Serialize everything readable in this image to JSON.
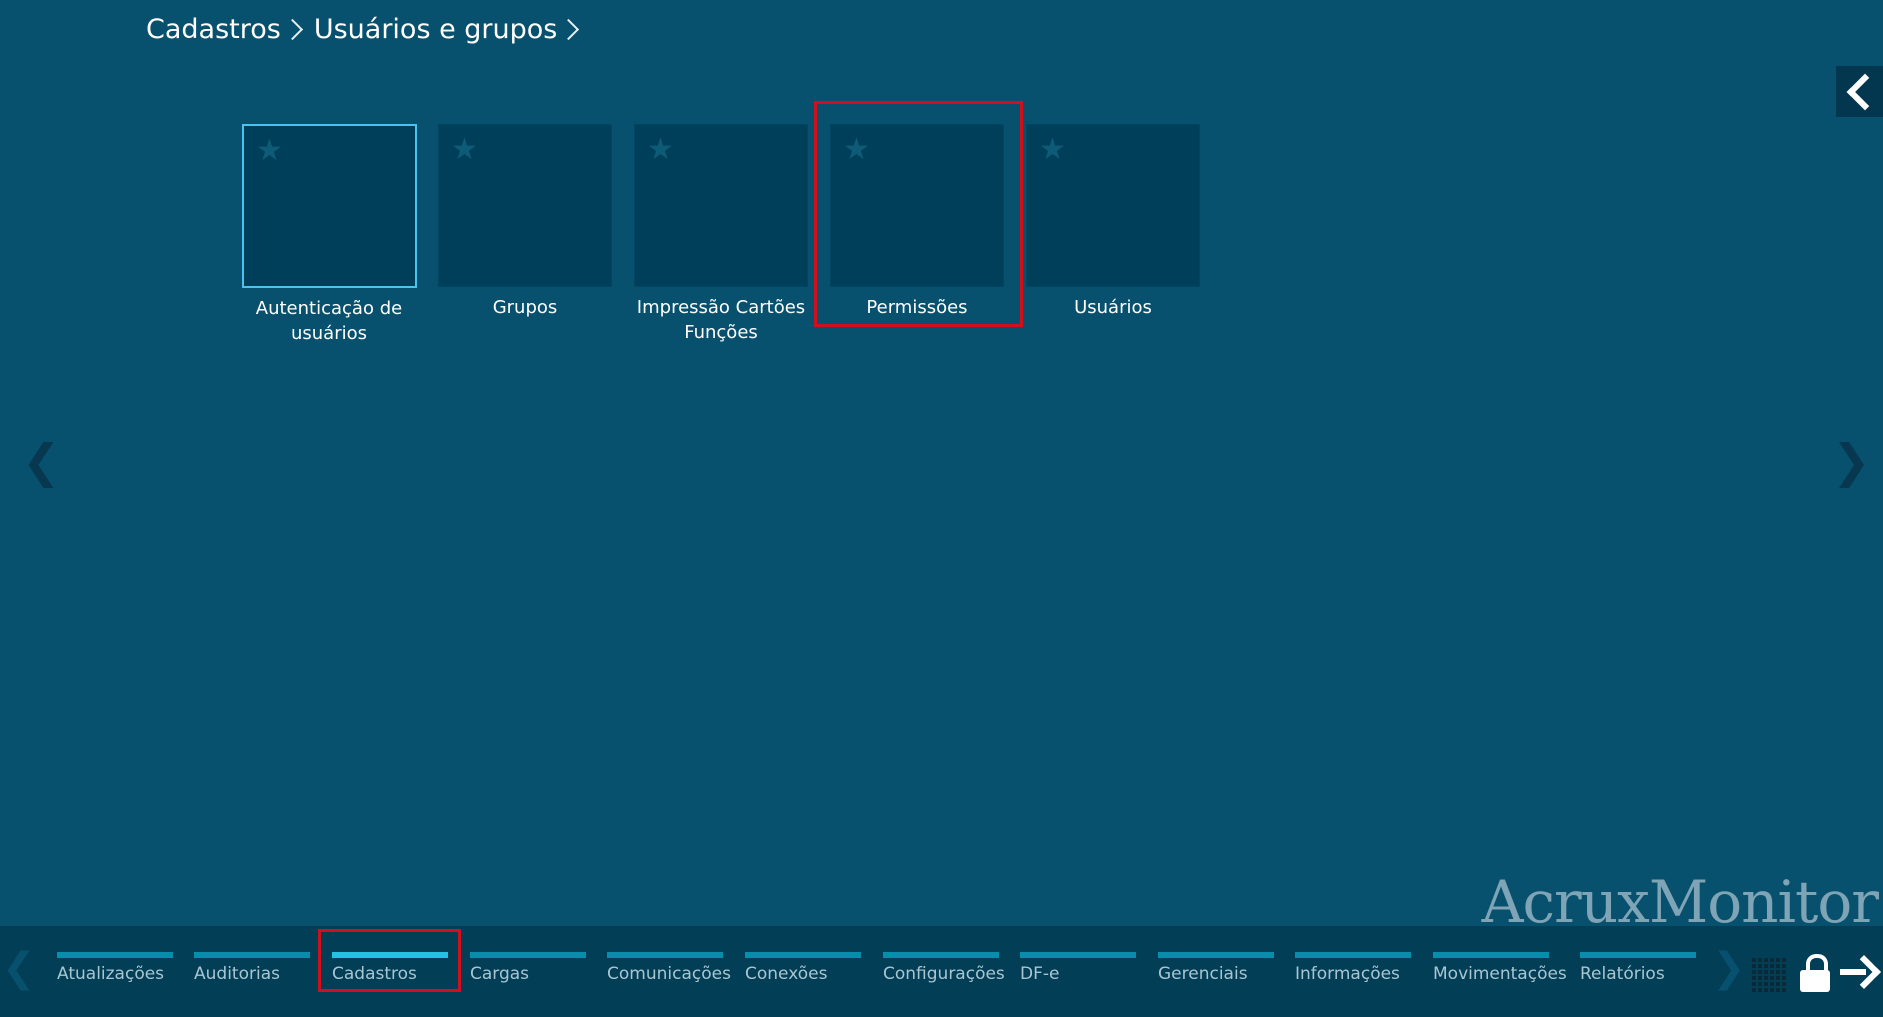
{
  "breadcrumb": {
    "items": [
      "Cadastros",
      "Usuários e grupos"
    ]
  },
  "tiles": [
    {
      "label": "Autenticação de usuários",
      "selected": true
    },
    {
      "label": "Grupos",
      "selected": false
    },
    {
      "label": "Impressão Cartões Funções",
      "selected": false
    },
    {
      "label": "Permissões",
      "selected": false,
      "highlighted": true
    },
    {
      "label": "Usuários",
      "selected": false
    }
  ],
  "watermark": "AcruxMonitor",
  "footer": {
    "nav": [
      {
        "label": "Atualizações"
      },
      {
        "label": "Auditorias"
      },
      {
        "label": "Cadastros",
        "active": true,
        "highlighted": true
      },
      {
        "label": "Cargas"
      },
      {
        "label": "Comunicações"
      },
      {
        "label": "Conexões"
      },
      {
        "label": "Configurações"
      },
      {
        "label": "DF-e"
      },
      {
        "label": "Gerenciais"
      },
      {
        "label": "Informações"
      },
      {
        "label": "Movimentações"
      },
      {
        "label": "Relatórios"
      }
    ],
    "icons": [
      "grid-icon",
      "lock-icon",
      "logout-arrow-icon"
    ]
  },
  "colors": {
    "background": "#07516f",
    "tile": "#003f5a",
    "selected_border": "#4cc3ee",
    "highlight": "#d0101c",
    "footer": "#033e57",
    "nav_bar": "#0a8cac",
    "nav_bar_active": "#23c1e4"
  }
}
